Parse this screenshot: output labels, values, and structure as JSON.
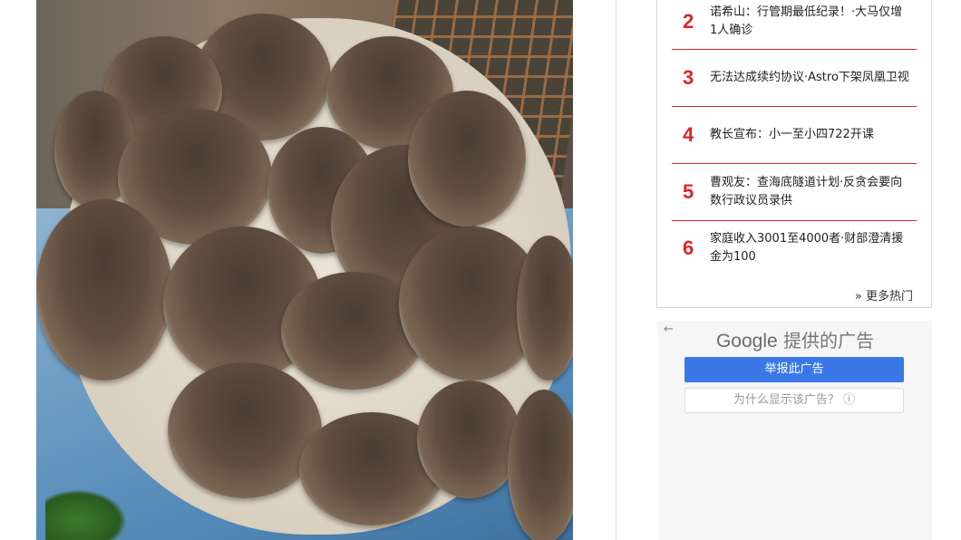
{
  "hot_list": {
    "items": [
      {
        "rank": "2",
        "text": "诺希山：行管期最低纪录！·大马仅增1人确诊"
      },
      {
        "rank": "3",
        "text": "无法达成续约协议·Astro下架凤凰卫视"
      },
      {
        "rank": "4",
        "text": "教长宣布：小一至小四722开课"
      },
      {
        "rank": "5",
        "text": "曹观友：查海底隧道计划·反贪会要向数行政议员录供"
      },
      {
        "rank": "6",
        "text": "家庭收入3001至4000者·财部澄清援金为100"
      }
    ],
    "more_label": "» 更多热门"
  },
  "ad": {
    "back_icon": "←",
    "title_brand": "Google",
    "title_suffix": " 提供的广告",
    "report_label": "举报此广告",
    "why_label": "为什么显示该广告？ ⓘ"
  },
  "colors": {
    "accent_red": "#d9262b",
    "ad_blue": "#3b78e7"
  }
}
